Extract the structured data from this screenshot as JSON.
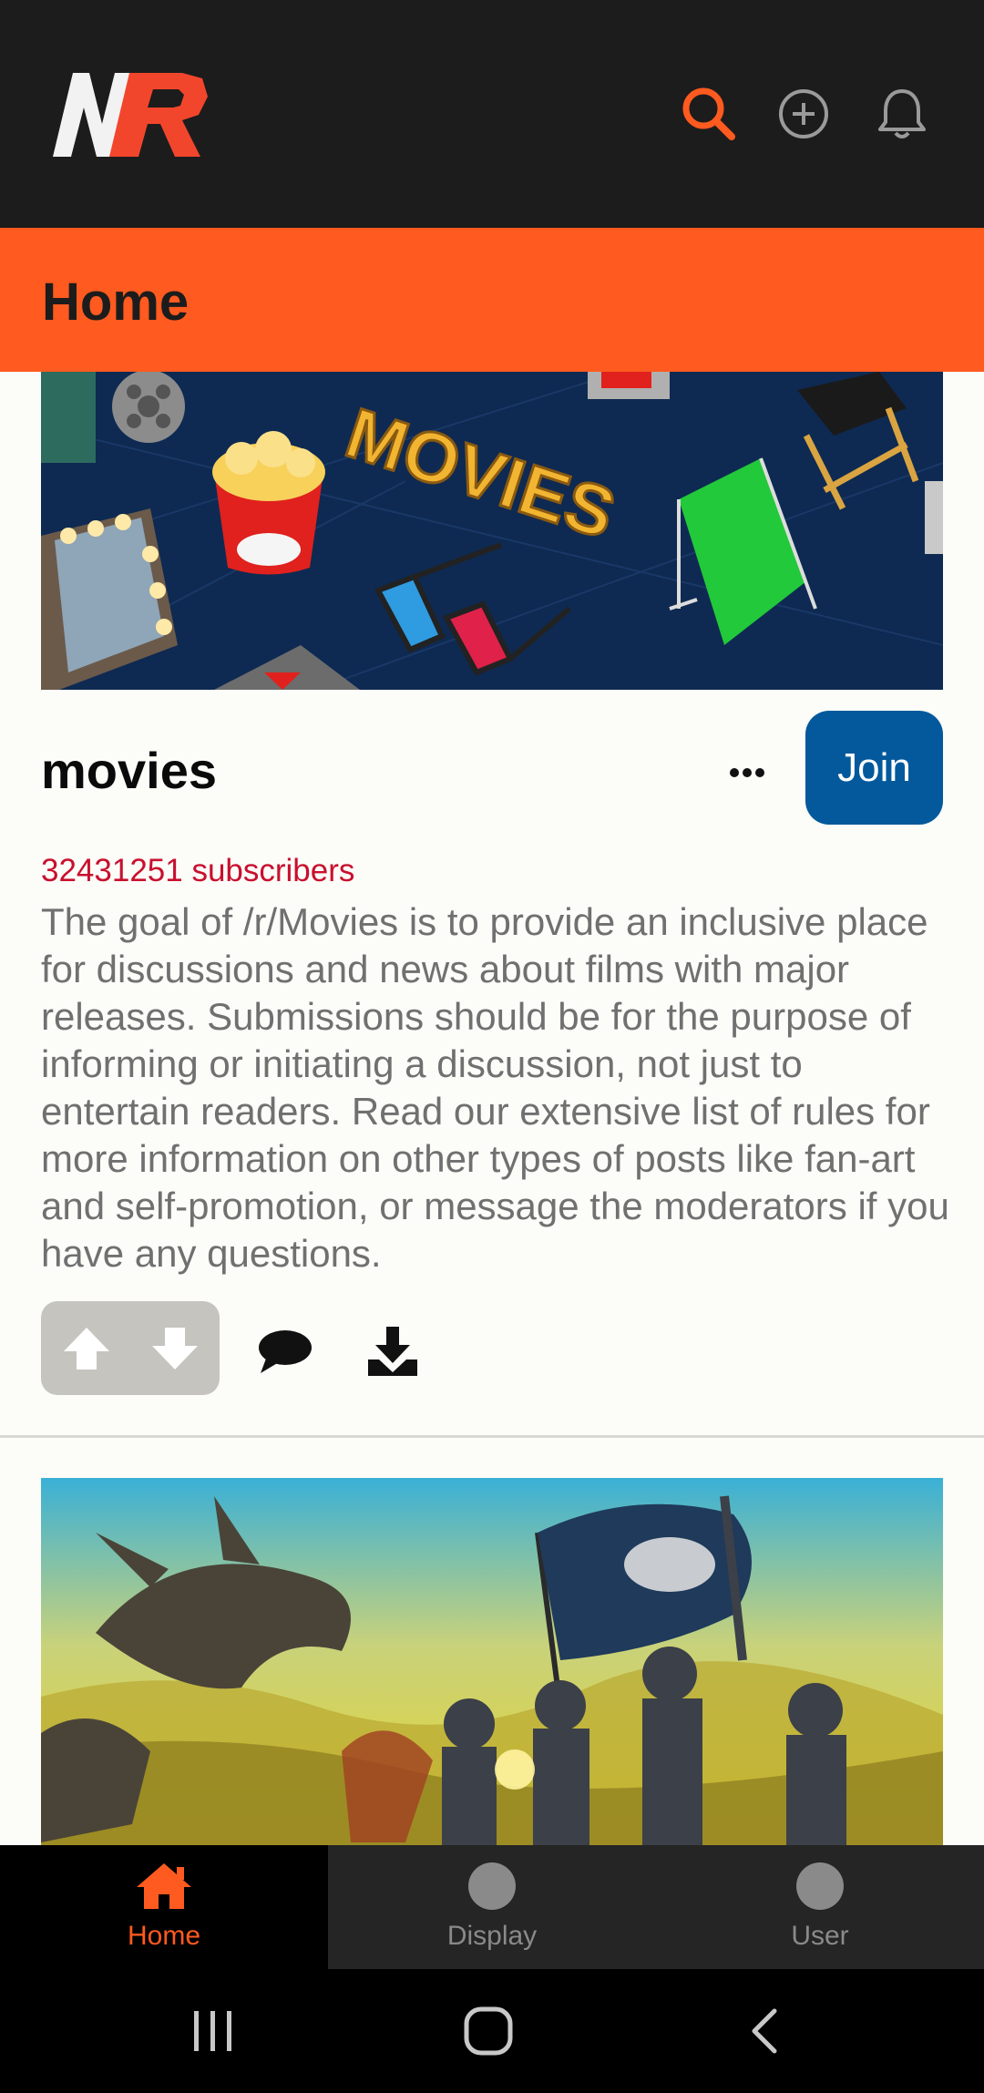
{
  "app": {
    "logo_text": "NR",
    "accent_color": "#FF5A1F",
    "top_icons": [
      "search-icon",
      "add-circle-icon",
      "bell-icon"
    ]
  },
  "header": {
    "title": "Home"
  },
  "post": {
    "banner_text": "MOVIES",
    "community": "movies",
    "join_label": "Join",
    "subscribers": "32431251 subscribers",
    "description": "The goal of /r/Movies is to provide an inclusive place for discussions and news about films with major releases. Submissions should be for the purpose of informing or initiating a discussion, not just to entertain readers. Read our extensive list of rules for more information on other types of posts like fan-art and self-promotion, or message the moderators if you have any questions.",
    "actions": [
      "upvote-icon",
      "downvote-icon",
      "comment-icon",
      "download-icon"
    ]
  },
  "bottom_nav": {
    "items": [
      {
        "label": "Home",
        "icon": "home-icon",
        "active": true
      },
      {
        "label": "Display",
        "icon": "circle-icon",
        "active": false
      },
      {
        "label": "User",
        "icon": "circle-icon",
        "active": false
      }
    ]
  },
  "system_nav": [
    "recents-icon",
    "home-button-icon",
    "back-icon"
  ]
}
